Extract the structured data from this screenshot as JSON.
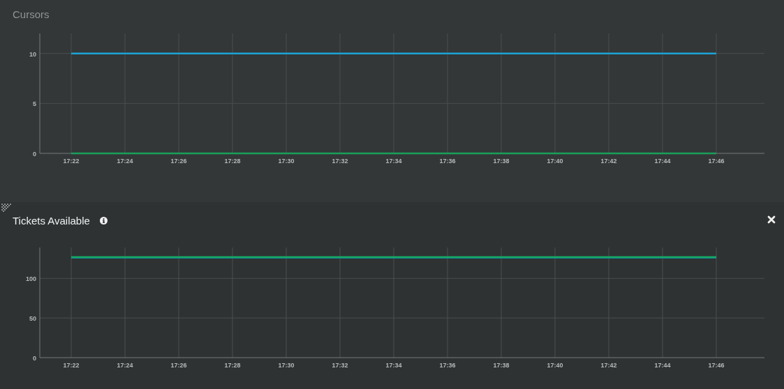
{
  "panels": [
    {
      "title": "Cursors",
      "active": false,
      "info": false,
      "closable": false,
      "chart_data": {
        "type": "line",
        "grid": true,
        "ylim": [
          0,
          12
        ],
        "yticks": [
          0,
          5,
          10
        ],
        "categories": [
          "17:22",
          "17:24",
          "17:26",
          "17:28",
          "17:30",
          "17:32",
          "17:34",
          "17:36",
          "17:38",
          "17:40",
          "17:42",
          "17:44",
          "17:46"
        ],
        "series": [
          {
            "color": "#1ba3d6",
            "values": [
              10,
              10,
              10,
              10,
              10,
              10,
              10,
              10,
              10,
              10,
              10,
              10,
              10
            ]
          },
          {
            "color": "#1a9e5a",
            "values": [
              0,
              0,
              0,
              0,
              0,
              0,
              0,
              0,
              0,
              0,
              0,
              0,
              0
            ]
          }
        ]
      }
    },
    {
      "title": "Tickets Available",
      "active": true,
      "info": true,
      "closable": true,
      "chart_data": {
        "type": "line",
        "grid": true,
        "ylim": [
          0,
          139
        ],
        "yticks": [
          0,
          50,
          100
        ],
        "categories": [
          "17:22",
          "17:24",
          "17:26",
          "17:28",
          "17:30",
          "17:32",
          "17:34",
          "17:36",
          "17:38",
          "17:40",
          "17:42",
          "17:44",
          "17:46"
        ],
        "series": [
          {
            "color": "#137a8c",
            "values": [
              126,
              126,
              126,
              126,
              126,
              126,
              126,
              126,
              126,
              126,
              126,
              126,
              126
            ]
          },
          {
            "color": "#16a864",
            "values": [
              127,
              127,
              127,
              127,
              127,
              127,
              127,
              127,
              127,
              127,
              127,
              127,
              127
            ]
          }
        ]
      }
    }
  ]
}
